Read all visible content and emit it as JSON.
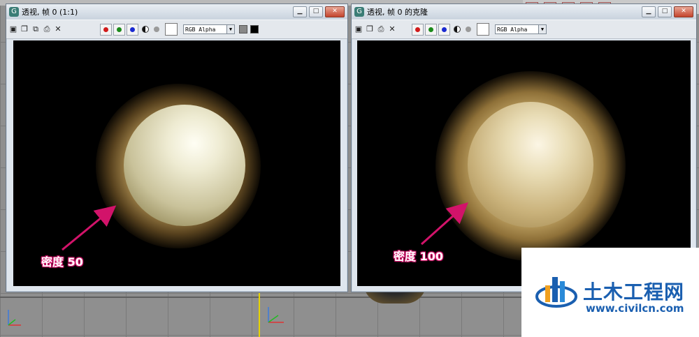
{
  "left_window": {
    "title": "透视, 帧 0 (1:1)",
    "channel_select": "RGB Alpha",
    "annotation": "密度 50"
  },
  "right_window": {
    "title": "透视, 帧 0 的克隆",
    "channel_select": "RGB Alpha",
    "annotation": "密度 100"
  },
  "window_buttons": {
    "minimize": "▁",
    "maximize": "□",
    "close": "✕"
  },
  "toolbar_icons": [
    "save-icon",
    "copy-icon",
    "clone-icon",
    "print-icon",
    "clear-icon"
  ],
  "channel_colors": {
    "red": "#d11a1a",
    "green": "#1a8a1a",
    "blue": "#1a2ad1"
  },
  "colors": {
    "annotation_accent": "#d2136a",
    "fur": "#b99a5a",
    "sphere_light": "#f2f0dc"
  },
  "watermark": {
    "brand": "土木工程网",
    "url": "www.civilcn.com"
  }
}
